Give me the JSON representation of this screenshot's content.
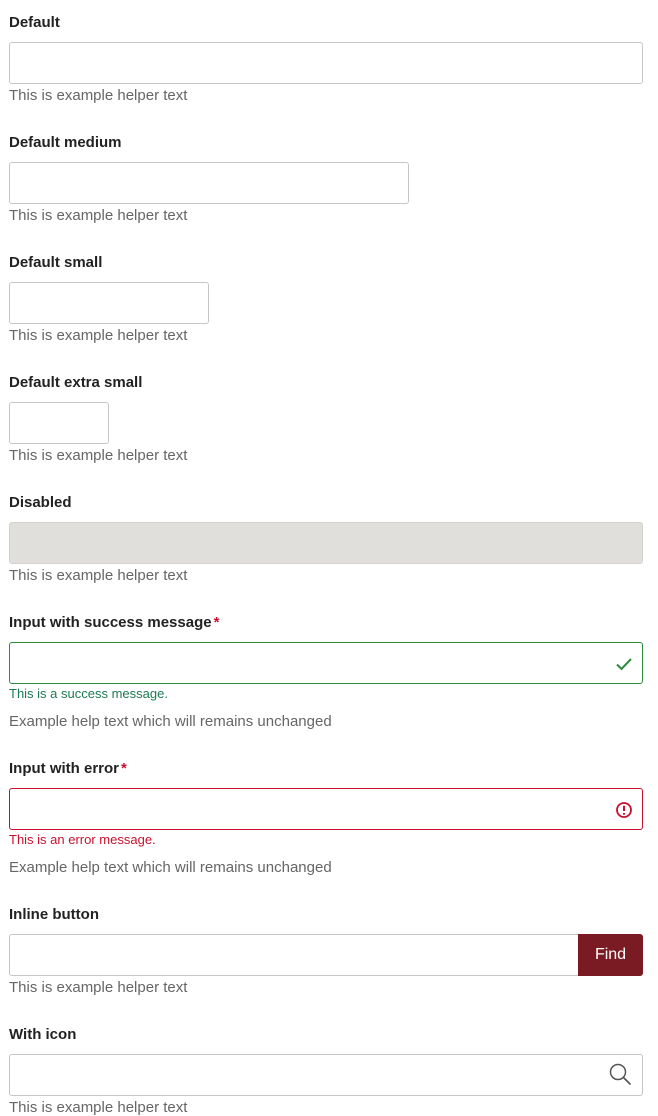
{
  "fields": {
    "default": {
      "label": "Default",
      "helper": "This is example helper text"
    },
    "default_medium": {
      "label": "Default medium",
      "helper": "This is example helper text"
    },
    "default_small": {
      "label": "Default small",
      "helper": "This is example helper text"
    },
    "default_xsmall": {
      "label": "Default extra small",
      "helper": "This is example helper text"
    },
    "disabled": {
      "label": "Disabled",
      "helper": "This is example helper text"
    },
    "success": {
      "label": "Input with success message",
      "required_mark": "*",
      "message": "This is a success message.",
      "helper": "Example help text which will remains unchanged",
      "icon": "checkmark-icon"
    },
    "error": {
      "label": "Input with error",
      "required_mark": "*",
      "message": "This is an error message.",
      "helper": "Example help text which will remains unchanged",
      "icon": "error-circle-icon"
    },
    "inline_button": {
      "label": "Inline button",
      "button_label": "Find",
      "helper": "This is example helper text"
    },
    "with_icon": {
      "label": "With icon",
      "helper": "This is example helper text",
      "icon": "search-icon"
    }
  },
  "colors": {
    "success": "#2e8b3e",
    "error": "#c8102e",
    "button": "#7a1a23",
    "disabled_bg": "#e1dfdb"
  }
}
